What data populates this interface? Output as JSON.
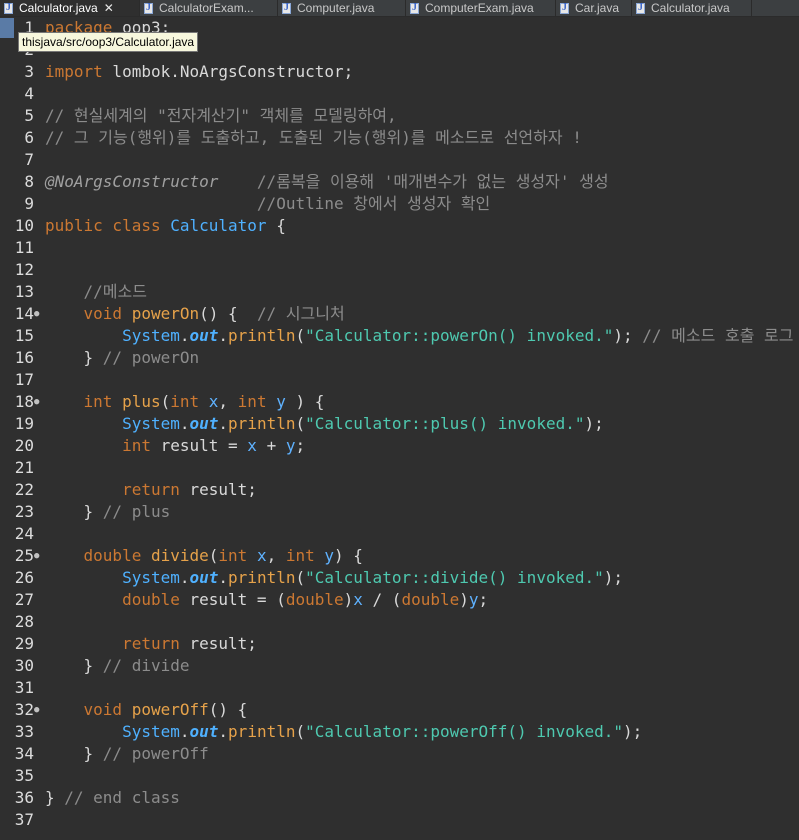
{
  "tabs": [
    {
      "label": "Calculator.java",
      "active": true
    },
    {
      "label": "CalculatorExam...",
      "active": false
    },
    {
      "label": "Computer.java",
      "active": false
    },
    {
      "label": "ComputerExam.java",
      "active": false
    },
    {
      "label": "Car.java",
      "active": false
    },
    {
      "label": "Calculator.java",
      "active": false
    }
  ],
  "tooltip": "thisjava/src/oop3/Calculator.java",
  "lines": [
    {
      "n": "1",
      "fold": "",
      "tokens": [
        [
          "kw",
          "package"
        ],
        [
          "plain",
          " oop3;"
        ]
      ]
    },
    {
      "n": "2",
      "fold": "",
      "tokens": []
    },
    {
      "n": "3",
      "fold": "",
      "tokens": [
        [
          "kw",
          "import"
        ],
        [
          "plain",
          " lombok.NoArgsConstructor;"
        ]
      ]
    },
    {
      "n": "4",
      "fold": "",
      "tokens": []
    },
    {
      "n": "5",
      "fold": "",
      "tokens": [
        [
          "cm",
          "// 현실세계의 \"전자계산기\" 객체를 모델링하여,"
        ]
      ]
    },
    {
      "n": "6",
      "fold": "",
      "tokens": [
        [
          "cm",
          "// 그 기능(행위)를 도출하고, 도출된 기능(행위)를 메소드로 선언하자 !"
        ]
      ]
    },
    {
      "n": "7",
      "fold": "",
      "tokens": []
    },
    {
      "n": "8",
      "fold": "",
      "tokens": [
        [
          "ann",
          "@NoArgsConstructor"
        ],
        [
          "plain",
          "    "
        ],
        [
          "cm",
          "//롬복을 이용해 '매개변수가 없는 생성자' 생성"
        ]
      ]
    },
    {
      "n": "9",
      "fold": "",
      "tokens": [
        [
          "plain",
          "                      "
        ],
        [
          "cm",
          "//Outline 창에서 생성자 확인"
        ]
      ]
    },
    {
      "n": "10",
      "fold": "",
      "tokens": [
        [
          "kw",
          "public class "
        ],
        [
          "cls",
          "Calculator"
        ],
        [
          "plain",
          " {"
        ]
      ]
    },
    {
      "n": "11",
      "fold": "",
      "tokens": []
    },
    {
      "n": "12",
      "fold": "",
      "tokens": []
    },
    {
      "n": "13",
      "fold": "",
      "tokens": [
        [
          "plain",
          "    "
        ],
        [
          "cm",
          "//메소드"
        ]
      ]
    },
    {
      "n": "14",
      "fold": "●",
      "tokens": [
        [
          "plain",
          "    "
        ],
        [
          "kw",
          "void "
        ],
        [
          "meth",
          "powerOn"
        ],
        [
          "plain",
          "() {  "
        ],
        [
          "cm",
          "// 시그니처"
        ]
      ]
    },
    {
      "n": "15",
      "fold": "",
      "tokens": [
        [
          "plain",
          "        "
        ],
        [
          "cls",
          "System"
        ],
        [
          "plain",
          "."
        ],
        [
          "fld",
          "out"
        ],
        [
          "plain",
          "."
        ],
        [
          "meth",
          "println"
        ],
        [
          "plain",
          "("
        ],
        [
          "str",
          "\"Calculator::powerOn() invoked.\""
        ],
        [
          "plain",
          "); "
        ],
        [
          "cm",
          "// 메소드 호출 로그"
        ]
      ]
    },
    {
      "n": "16",
      "fold": "",
      "tokens": [
        [
          "plain",
          "    } "
        ],
        [
          "cm",
          "// powerOn"
        ]
      ]
    },
    {
      "n": "17",
      "fold": "",
      "tokens": []
    },
    {
      "n": "18",
      "fold": "●",
      "tokens": [
        [
          "plain",
          "    "
        ],
        [
          "kw",
          "int "
        ],
        [
          "meth",
          "plus"
        ],
        [
          "plain",
          "("
        ],
        [
          "kw",
          "int "
        ],
        [
          "var",
          "x"
        ],
        [
          "plain",
          ", "
        ],
        [
          "kw",
          "int "
        ],
        [
          "var",
          "y"
        ],
        [
          "plain",
          " ) {"
        ]
      ]
    },
    {
      "n": "19",
      "fold": "",
      "tokens": [
        [
          "plain",
          "        "
        ],
        [
          "cls",
          "System"
        ],
        [
          "plain",
          "."
        ],
        [
          "fld",
          "out"
        ],
        [
          "plain",
          "."
        ],
        [
          "meth",
          "println"
        ],
        [
          "plain",
          "("
        ],
        [
          "str",
          "\"Calculator::plus() invoked.\""
        ],
        [
          "plain",
          ");"
        ]
      ]
    },
    {
      "n": "20",
      "fold": "",
      "tokens": [
        [
          "plain",
          "        "
        ],
        [
          "kw",
          "int "
        ],
        [
          "plain",
          "result = "
        ],
        [
          "var",
          "x"
        ],
        [
          "plain",
          " + "
        ],
        [
          "var",
          "y"
        ],
        [
          "plain",
          ";"
        ]
      ]
    },
    {
      "n": "21",
      "fold": "",
      "tokens": []
    },
    {
      "n": "22",
      "fold": "",
      "tokens": [
        [
          "plain",
          "        "
        ],
        [
          "kw",
          "return "
        ],
        [
          "plain",
          "result;"
        ]
      ]
    },
    {
      "n": "23",
      "fold": "",
      "tokens": [
        [
          "plain",
          "    } "
        ],
        [
          "cm",
          "// plus"
        ]
      ]
    },
    {
      "n": "24",
      "fold": "",
      "tokens": []
    },
    {
      "n": "25",
      "fold": "●",
      "tokens": [
        [
          "plain",
          "    "
        ],
        [
          "kw",
          "double "
        ],
        [
          "meth",
          "divide"
        ],
        [
          "plain",
          "("
        ],
        [
          "kw",
          "int "
        ],
        [
          "var",
          "x"
        ],
        [
          "plain",
          ", "
        ],
        [
          "kw",
          "int "
        ],
        [
          "var",
          "y"
        ],
        [
          "plain",
          ") {"
        ]
      ]
    },
    {
      "n": "26",
      "fold": "",
      "tokens": [
        [
          "plain",
          "        "
        ],
        [
          "cls",
          "System"
        ],
        [
          "plain",
          "."
        ],
        [
          "fld",
          "out"
        ],
        [
          "plain",
          "."
        ],
        [
          "meth",
          "println"
        ],
        [
          "plain",
          "("
        ],
        [
          "str",
          "\"Calculator::divide() invoked.\""
        ],
        [
          "plain",
          ");"
        ]
      ]
    },
    {
      "n": "27",
      "fold": "",
      "tokens": [
        [
          "plain",
          "        "
        ],
        [
          "kw",
          "double "
        ],
        [
          "plain",
          "result = ("
        ],
        [
          "kw",
          "double"
        ],
        [
          "plain",
          ")"
        ],
        [
          "var",
          "x"
        ],
        [
          "plain",
          " / ("
        ],
        [
          "kw",
          "double"
        ],
        [
          "plain",
          ")"
        ],
        [
          "var",
          "y"
        ],
        [
          "plain",
          ";"
        ]
      ]
    },
    {
      "n": "28",
      "fold": "",
      "tokens": []
    },
    {
      "n": "29",
      "fold": "",
      "tokens": [
        [
          "plain",
          "        "
        ],
        [
          "kw",
          "return "
        ],
        [
          "plain",
          "result;"
        ]
      ]
    },
    {
      "n": "30",
      "fold": "",
      "tokens": [
        [
          "plain",
          "    } "
        ],
        [
          "cm",
          "// divide"
        ]
      ]
    },
    {
      "n": "31",
      "fold": "",
      "tokens": []
    },
    {
      "n": "32",
      "fold": "●",
      "tokens": [
        [
          "plain",
          "    "
        ],
        [
          "kw",
          "void "
        ],
        [
          "meth",
          "powerOff"
        ],
        [
          "plain",
          "() {"
        ]
      ]
    },
    {
      "n": "33",
      "fold": "",
      "tokens": [
        [
          "plain",
          "        "
        ],
        [
          "cls",
          "System"
        ],
        [
          "plain",
          "."
        ],
        [
          "fld",
          "out"
        ],
        [
          "plain",
          "."
        ],
        [
          "meth",
          "println"
        ],
        [
          "plain",
          "("
        ],
        [
          "str",
          "\"Calculator::powerOff() invoked.\""
        ],
        [
          "plain",
          ");"
        ]
      ]
    },
    {
      "n": "34",
      "fold": "",
      "tokens": [
        [
          "plain",
          "    } "
        ],
        [
          "cm",
          "// powerOff"
        ]
      ]
    },
    {
      "n": "35",
      "fold": "",
      "tokens": []
    },
    {
      "n": "36",
      "fold": "",
      "tokens": [
        [
          "plain",
          "} "
        ],
        [
          "cm",
          "// end class"
        ]
      ]
    },
    {
      "n": "37",
      "fold": "",
      "tokens": []
    }
  ]
}
